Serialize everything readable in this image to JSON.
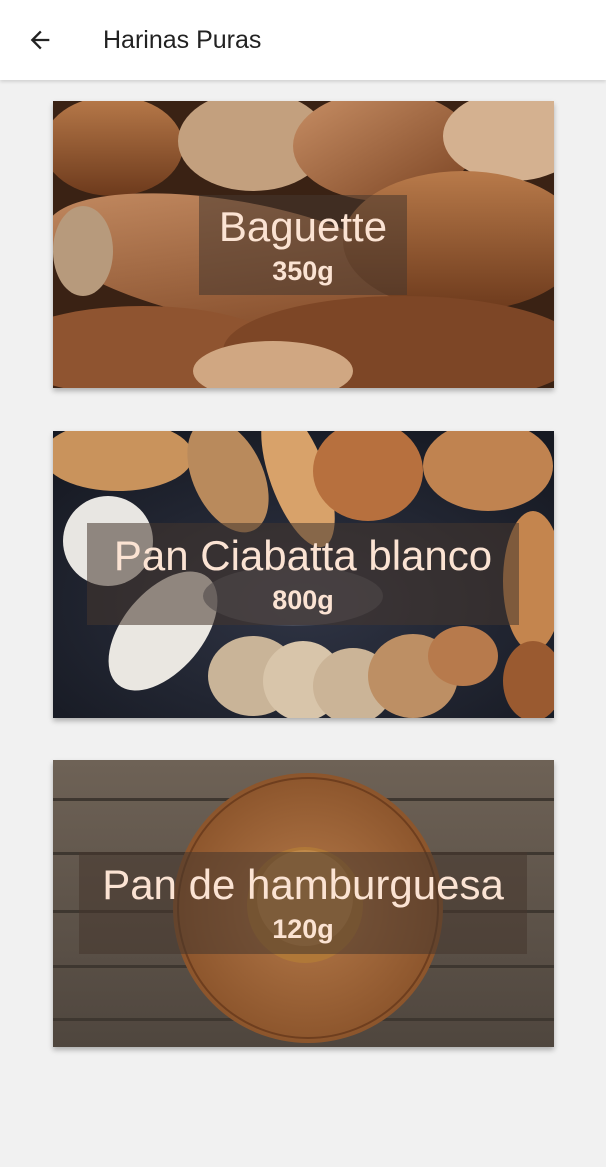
{
  "appbar": {
    "title": "Harinas Puras",
    "back_icon": "arrow-left-icon"
  },
  "cards": [
    {
      "name": "Baguette",
      "weight": "350g",
      "image": "baguettes-photo"
    },
    {
      "name": "Pan Ciabatta blanco",
      "weight": "800g",
      "image": "ciabatta-breads-flour-photo"
    },
    {
      "name": "Pan de hamburguesa",
      "weight": "120g",
      "image": "burger-bun-on-wooden-board-photo"
    }
  ],
  "colors": {
    "background": "#f1f1f1",
    "appbar": "#ffffff",
    "label_text": "#fbe3d3"
  }
}
